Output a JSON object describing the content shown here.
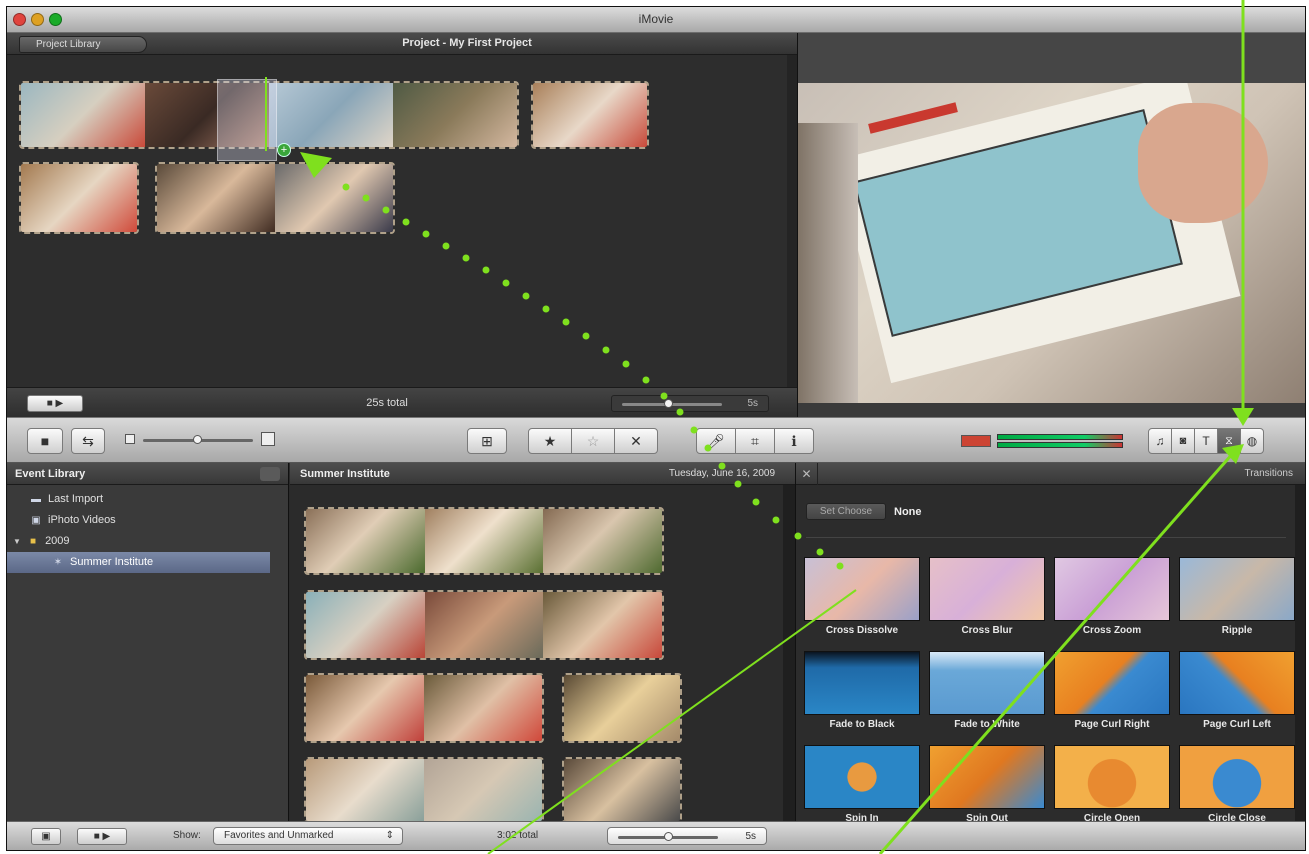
{
  "window": {
    "title": "iMovie",
    "traffic_colors": [
      "#e0443e",
      "#dea123",
      "#1aab29"
    ]
  },
  "project": {
    "library_button": "Project Library",
    "title": "Project - My First Project",
    "total": "25s total",
    "duration_label": "5s"
  },
  "event_library": {
    "header": "Event Library",
    "items": [
      {
        "label": "Last Import",
        "icon": "film-icon"
      },
      {
        "label": "iPhoto Videos",
        "icon": "photo-icon"
      },
      {
        "label": "2009",
        "icon": "folder-icon"
      },
      {
        "label": "Summer Institute",
        "icon": "star-icon"
      }
    ]
  },
  "events": {
    "title": "Summer Institute",
    "date": "Tuesday, June 16, 2009"
  },
  "transitions": {
    "title": "Transitions",
    "set_choose": "Set Choose",
    "choose_value": "None",
    "items": [
      {
        "label": "Cross Dissolve"
      },
      {
        "label": "Cross Blur"
      },
      {
        "label": "Cross Zoom"
      },
      {
        "label": "Ripple"
      },
      {
        "label": "Fade to Black"
      },
      {
        "label": "Fade to White"
      },
      {
        "label": "Page Curl Right"
      },
      {
        "label": "Page Curl Left"
      },
      {
        "label": "Spin In"
      },
      {
        "label": "Spin Out"
      },
      {
        "label": "Circle Open"
      },
      {
        "label": "Circle Close"
      }
    ]
  },
  "bottom_bar": {
    "show_label": "Show:",
    "show_value": "Favorites and Unmarked",
    "total": "3:02 total",
    "duration_label": "5s"
  },
  "annotation_color": "#7fe01e"
}
